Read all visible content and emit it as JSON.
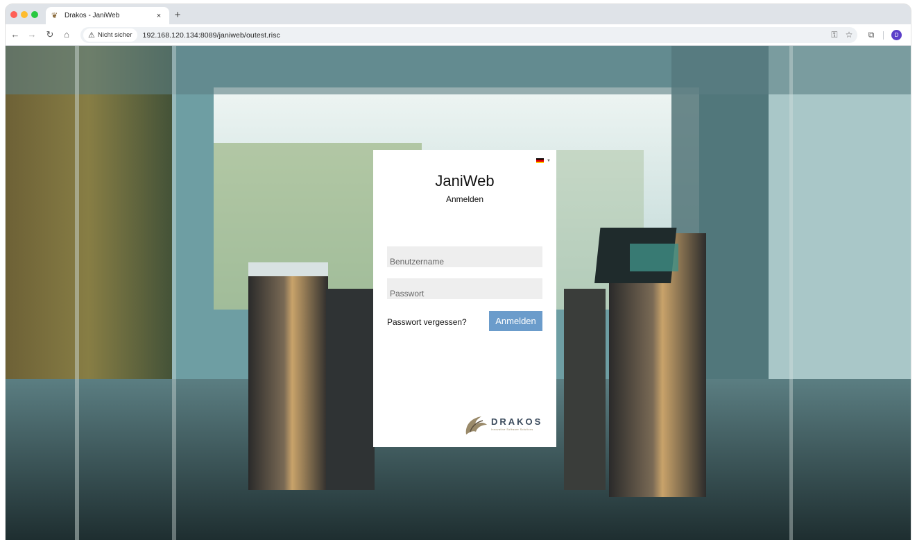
{
  "browser": {
    "tab_title": "Drakos - JaniWeb",
    "tab_close": "×",
    "new_tab": "+",
    "security_label": "Nicht sicher",
    "url": "192.168.120.134:8089/janiweb/outest.risc",
    "profile_initial": "D",
    "icons": [
      "back-icon",
      "forward-icon",
      "reload-icon",
      "home-icon",
      "warning-icon",
      "key-icon",
      "star-icon",
      "extensions-icon"
    ]
  },
  "login": {
    "title": "JaniWeb",
    "subtitle": "Anmelden",
    "username_placeholder": "Benutzername",
    "password_placeholder": "Passwort",
    "forgot_label": "Passwort vergessen?",
    "submit_label": "Anmelden",
    "language": "de"
  },
  "brand": {
    "name": "DRAKOS",
    "tagline": "Innovative Software Solutions",
    "button_color": "#6b9ccb"
  }
}
